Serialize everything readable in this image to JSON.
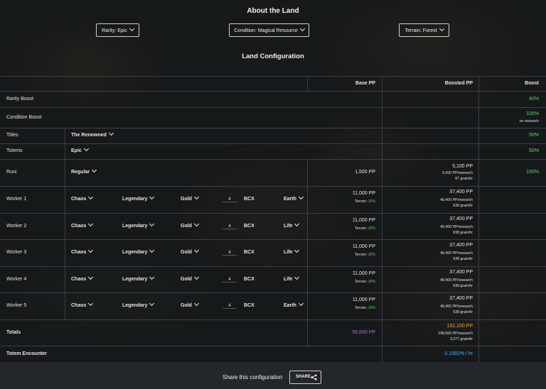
{
  "header": {
    "title": "About the Land",
    "section_title": "Land Configuration"
  },
  "filters": {
    "rarity": "Rarity: Epic",
    "condition": "Condition: Magical Resource",
    "terrain": "Terrain: Forest"
  },
  "columns": {
    "base": "Base PP",
    "boosted": "Boosted PP",
    "boost": "Boost"
  },
  "rows": {
    "rarity": {
      "label": "Rarity Boost",
      "boost": "40%"
    },
    "condition": {
      "label": "Condition Boost",
      "boost": "100%",
      "boost_sub": "on research"
    },
    "titles": {
      "label": "Titles",
      "select": "The Renowned",
      "boost": "50%"
    },
    "totems": {
      "label": "Totems",
      "select": "Epic",
      "boost": "50%"
    },
    "runi": {
      "label": "Runi",
      "select": "Regular",
      "base": "1,500 PP",
      "boosted": "5,100 PP",
      "sub1": "6,600 PP/research",
      "sub2": "87 grain/hr",
      "boost": "100%"
    }
  },
  "workers": [
    {
      "label": "Worker 1",
      "type": "Chaos",
      "rarity": "Legendary",
      "foil": "Gold",
      "bcx": "4",
      "bcx_label": "BCX",
      "element": "Earth",
      "base": "11,000 PP",
      "terrain_label": "Terrain:",
      "terrain_pct": "10%",
      "boosted": "37,400 PP",
      "sub1": "48,400 PP/research",
      "sub2": "638 grain/hr"
    },
    {
      "label": "Worker 2",
      "type": "Chaos",
      "rarity": "Legendary",
      "foil": "Gold",
      "bcx": "4",
      "bcx_label": "BCX",
      "element": "Life",
      "base": "11,000 PP",
      "terrain_label": "Terrain:",
      "terrain_pct": "10%",
      "boosted": "37,400 PP",
      "sub1": "48,400 PP/research",
      "sub2": "638 grain/hr"
    },
    {
      "label": "Worker 3",
      "type": "Chaos",
      "rarity": "Legendary",
      "foil": "Gold",
      "bcx": "4",
      "bcx_label": "BCX",
      "element": "Life",
      "base": "11,000 PP",
      "terrain_label": "Terrain:",
      "terrain_pct": "10%",
      "boosted": "37,400 PP",
      "sub1": "48,400 PP/research",
      "sub2": "638 grain/hr"
    },
    {
      "label": "Worker 4",
      "type": "Chaos",
      "rarity": "Legendary",
      "foil": "Gold",
      "bcx": "4",
      "bcx_label": "BCX",
      "element": "Life",
      "base": "11,000 PP",
      "terrain_label": "Terrain:",
      "terrain_pct": "10%",
      "boosted": "37,400 PP",
      "sub1": "48,400 PP/research",
      "sub2": "638 grain/hr"
    },
    {
      "label": "Worker 5",
      "type": "Chaos",
      "rarity": "Legendary",
      "foil": "Gold",
      "bcx": "4",
      "bcx_label": "BCX",
      "element": "Earth",
      "base": "11,000 PP",
      "terrain_label": "Terrain:",
      "terrain_pct": "10%",
      "boosted": "37,400 PP",
      "sub1": "48,400 PP/research",
      "sub2": "638 grain/hr"
    }
  ],
  "totals": {
    "label": "Totals",
    "base": "56,500 PP",
    "boosted": "192,100 PP",
    "sub1": "248,600 PP/research",
    "sub2": "3,277 grain/hr"
  },
  "totem_encounter": {
    "label": "Totem Encounter",
    "value": "0.1582% / hr"
  },
  "footer": {
    "share_text": "Share this configuration",
    "share_button": "SHARE"
  },
  "colors": {
    "green": "#5fd35f",
    "purple": "#b76ce0",
    "orange": "#f5a623",
    "blue": "#4ab0ff"
  }
}
